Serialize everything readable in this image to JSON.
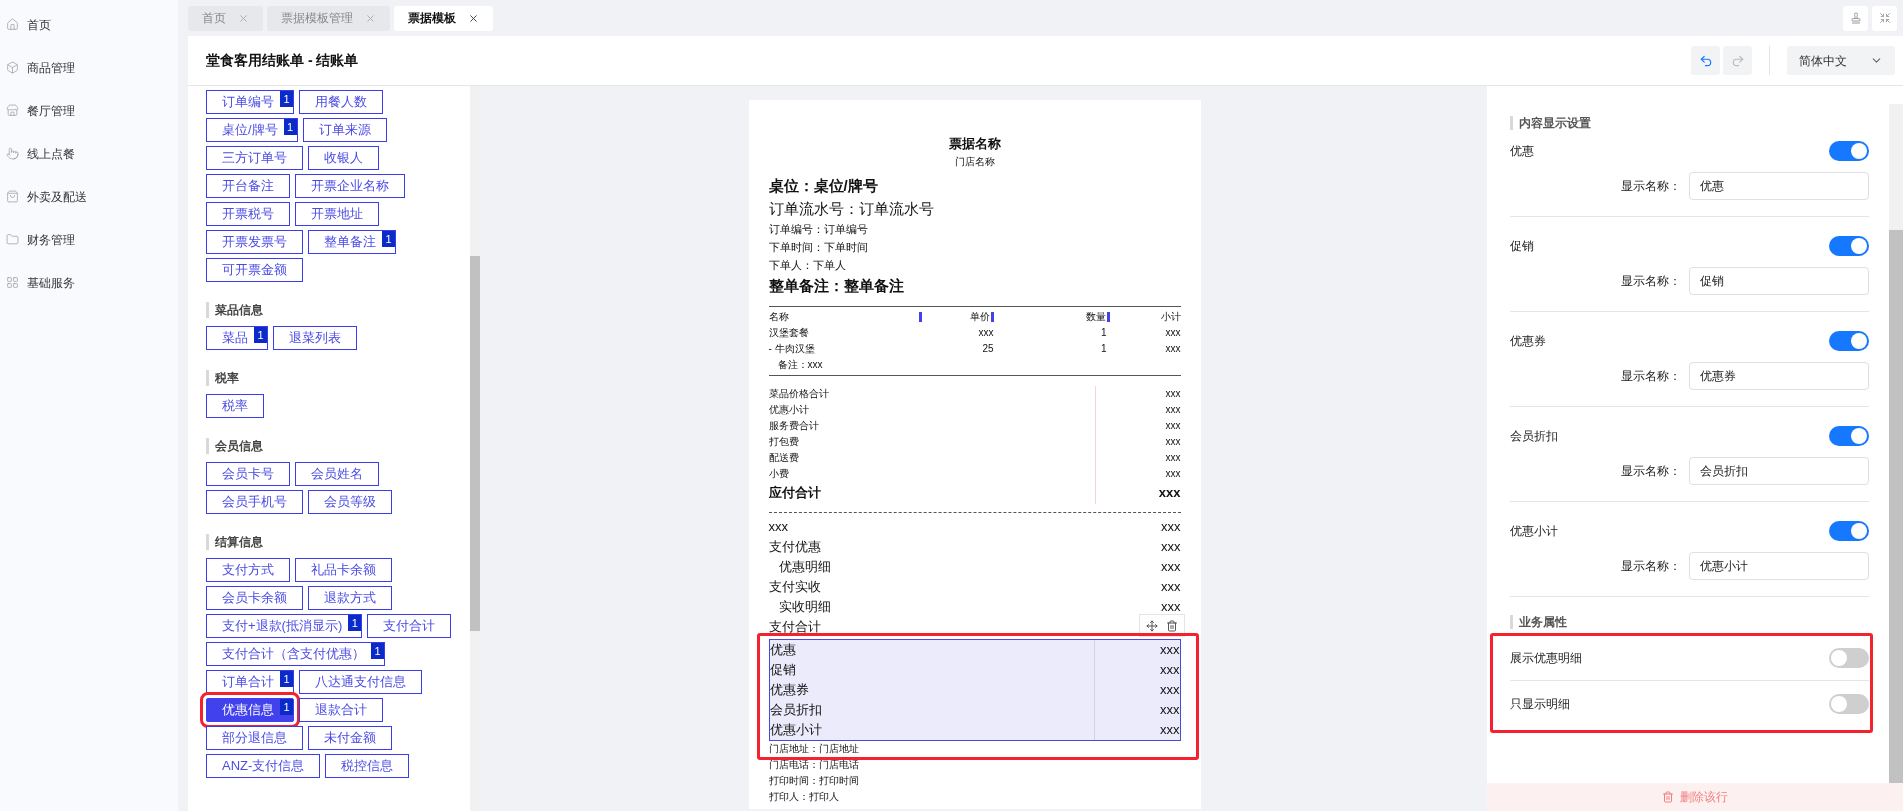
{
  "sidebar": {
    "items": [
      {
        "label": "首页"
      },
      {
        "label": "商品管理"
      },
      {
        "label": "餐厅管理"
      },
      {
        "label": "线上点餐"
      },
      {
        "label": "外卖及配送"
      },
      {
        "label": "财务管理"
      },
      {
        "label": "基础服务"
      }
    ]
  },
  "tabs": [
    {
      "label": "首页",
      "selected": false
    },
    {
      "label": "票据模板管理",
      "selected": false
    },
    {
      "label": "票据模板",
      "selected": true
    }
  ],
  "header": {
    "title": "堂食客用结账单 - 结账单",
    "language": "简体中文"
  },
  "field_panel": {
    "groups": [
      {
        "tags": [
          {
            "label": "订单编号",
            "badge": "1",
            "selected": false
          },
          {
            "label": "用餐人数",
            "selected": false
          },
          {
            "label": "桌位/牌号",
            "badge": "1",
            "selected": false
          },
          {
            "label": "订单来源",
            "selected": false
          },
          {
            "label": "三方订单号",
            "selected": false
          },
          {
            "label": "收银人",
            "selected": false
          },
          {
            "label": "开台备注",
            "selected": false
          },
          {
            "label": "开票企业名称",
            "selected": false
          },
          {
            "label": "开票税号",
            "selected": false
          },
          {
            "label": "开票地址",
            "selected": false
          },
          {
            "label": "开票发票号",
            "selected": false
          },
          {
            "label": "整单备注",
            "badge": "1",
            "selected": false
          },
          {
            "label": "可开票金额",
            "selected": false
          }
        ]
      },
      {
        "title": "菜品信息",
        "tags": [
          {
            "label": "菜品",
            "badge": "1",
            "selected": false
          },
          {
            "label": "退菜列表",
            "selected": false
          }
        ]
      },
      {
        "title": "税率",
        "tags": [
          {
            "label": "税率",
            "selected": false
          }
        ]
      },
      {
        "title": "会员信息",
        "tags": [
          {
            "label": "会员卡号",
            "selected": false
          },
          {
            "label": "会员姓名",
            "selected": false
          },
          {
            "label": "会员手机号",
            "selected": false
          },
          {
            "label": "会员等级",
            "selected": false
          }
        ]
      },
      {
        "title": "结算信息",
        "tags": [
          {
            "label": "支付方式",
            "selected": false
          },
          {
            "label": "礼品卡余额",
            "selected": false
          },
          {
            "label": "会员卡余额",
            "selected": false
          },
          {
            "label": "退款方式",
            "selected": false
          },
          {
            "label": "支付+退款(抵消显示)",
            "badge": "1",
            "selected": false
          },
          {
            "label": "支付合计",
            "selected": false
          },
          {
            "label": "支付合计（含支付优惠）",
            "badge": "1",
            "selected": false
          },
          {
            "label": "订单合计",
            "badge": "1",
            "selected": false
          },
          {
            "label": "八达通支付信息",
            "selected": false
          },
          {
            "label": "优惠信息",
            "badge": "1",
            "selected": true
          },
          {
            "label": "退款合计",
            "selected": false
          },
          {
            "label": "部分退信息",
            "selected": false
          },
          {
            "label": "未付金额",
            "selected": false
          },
          {
            "label": "ANZ-支付信息",
            "selected": false
          },
          {
            "label": "税控信息",
            "selected": false
          }
        ]
      }
    ]
  },
  "receipt": {
    "title": "票据名称",
    "store": "门店名称",
    "header_lines": [
      {
        "text": "桌位：桌位/牌号",
        "kind": "large_bold"
      },
      {
        "text": "订单流水号：订单流水号",
        "kind": "large"
      },
      {
        "text": "订单编号：订单编号",
        "kind": "small"
      },
      {
        "text": "下单时间：下单时间",
        "kind": "small"
      },
      {
        "text": "下单人：下单人",
        "kind": "small"
      },
      {
        "text": "整单备注：整单备注",
        "kind": "large_bold"
      }
    ],
    "columns": [
      "名称",
      "单价",
      "数量",
      "小计"
    ],
    "items": [
      {
        "cells": [
          "汉堡套餐",
          "xxx",
          "1",
          "xxx"
        ]
      },
      {
        "cells": [
          "- 牛肉汉堡",
          "25",
          "1",
          "xxx"
        ]
      }
    ],
    "item_note": "备注：xxx",
    "totals": [
      {
        "label": "菜品价格合计",
        "value": "xxx",
        "bold": false
      },
      {
        "label": "优惠小计",
        "value": "xxx",
        "bold": false
      },
      {
        "label": "服务费合计",
        "value": "xxx",
        "bold": false
      },
      {
        "label": "打包费",
        "value": "xxx",
        "bold": false
      },
      {
        "label": "配送费",
        "value": "xxx",
        "bold": false
      },
      {
        "label": "小费",
        "value": "xxx",
        "bold": false
      },
      {
        "label": "应付合计",
        "value": "xxx",
        "bold": true
      }
    ],
    "payments": [
      {
        "label": "xxx",
        "value": "xxx",
        "indent": false
      },
      {
        "label": "支付优惠",
        "value": "xxx",
        "indent": false
      },
      {
        "label": "优惠明细",
        "value": "xxx",
        "indent": true
      },
      {
        "label": "支付实收",
        "value": "xxx",
        "indent": false
      },
      {
        "label": "实收明细",
        "value": "xxx",
        "indent": true
      },
      {
        "label": "支付合计",
        "indent": false
      }
    ],
    "selected_block": {
      "highlighted": true,
      "rows": [
        {
          "label": "优惠",
          "value": "xxx"
        },
        {
          "label": "促销",
          "value": "xxx"
        },
        {
          "label": "优惠券",
          "value": "xxx"
        },
        {
          "label": "会员折扣",
          "value": "xxx"
        },
        {
          "label": "优惠小计",
          "value": "xxx"
        }
      ]
    },
    "footer_lines": [
      "门店地址：门店地址",
      "门店电话：门店电话",
      "打印时间：打印时间",
      "打印人：打印人"
    ]
  },
  "settings": {
    "sections": [
      {
        "title": "内容显示设置",
        "highlighted": false,
        "items": [
          {
            "kind": "named",
            "label": "优惠",
            "on": true,
            "name_label": "显示名称：",
            "name_value": "优惠"
          },
          {
            "kind": "named",
            "label": "促销",
            "on": true,
            "name_label": "显示名称：",
            "name_value": "促销"
          },
          {
            "kind": "named",
            "label": "优惠券",
            "on": true,
            "name_label": "显示名称：",
            "name_value": "优惠券"
          },
          {
            "kind": "named",
            "label": "会员折扣",
            "on": true,
            "name_label": "显示名称：",
            "name_value": "会员折扣"
          },
          {
            "kind": "named",
            "label": "优惠小计",
            "on": true,
            "name_label": "显示名称：",
            "name_value": "优惠小计"
          }
        ]
      },
      {
        "title": "业务属性",
        "highlighted": true,
        "items": [
          {
            "kind": "plain",
            "label": "展示优惠明细",
            "on": false
          },
          {
            "kind": "plain",
            "label": "只显示明细",
            "on": false
          }
        ]
      }
    ],
    "delete_button": "删除该行"
  }
}
